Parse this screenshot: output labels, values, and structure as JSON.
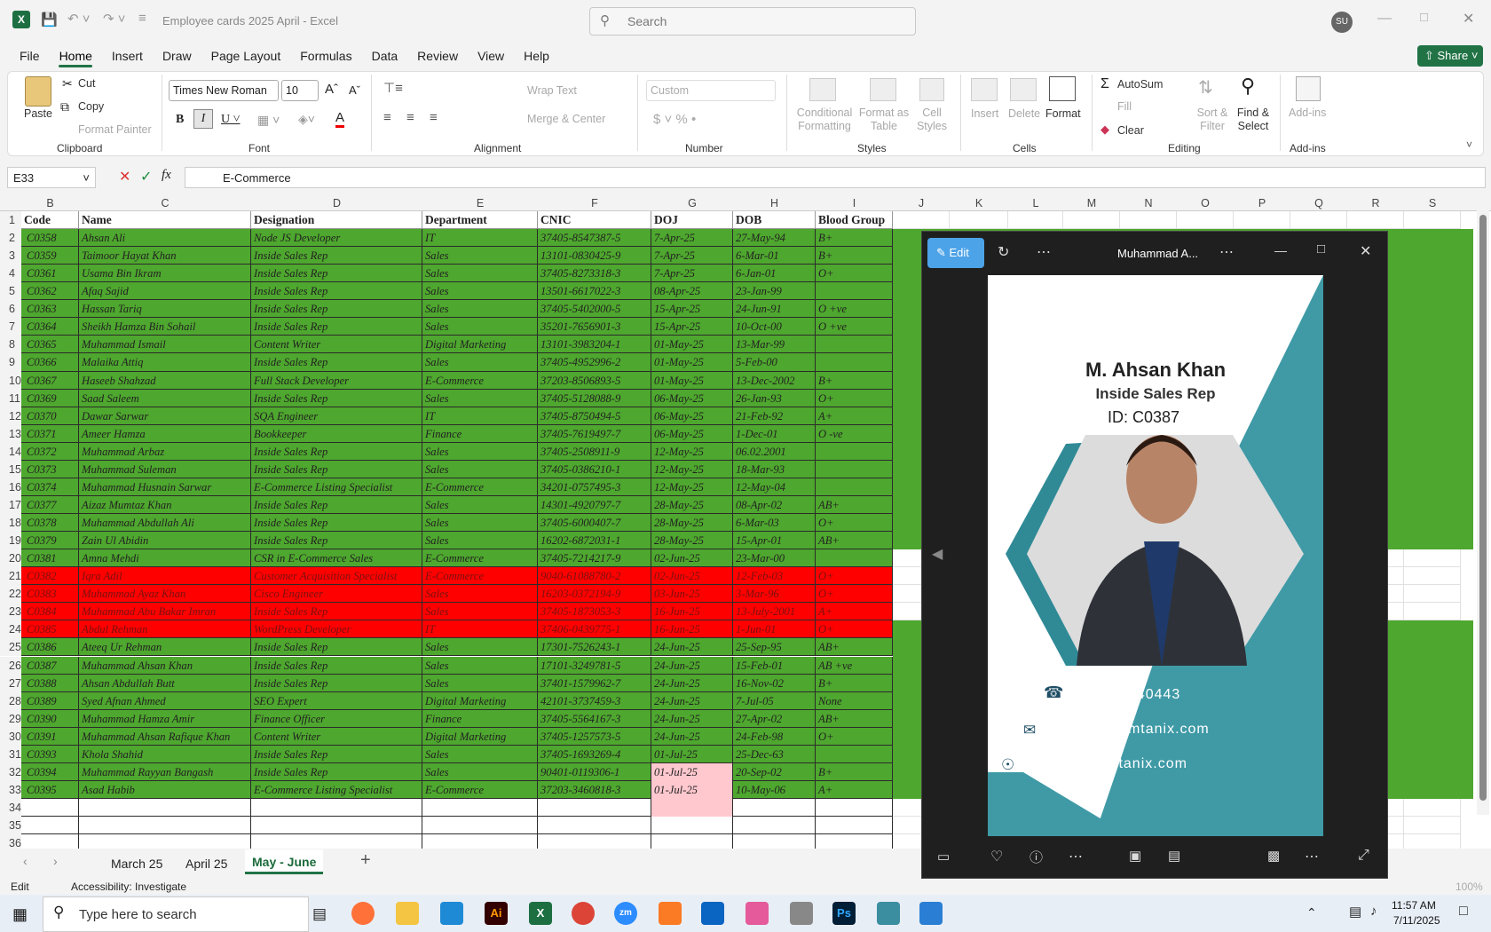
{
  "app": {
    "title": "Employee cards 2025 April - Excel",
    "search_placeholder": "Search",
    "avatar": "SU",
    "share": "Share"
  },
  "menu": [
    "File",
    "Home",
    "Insert",
    "Draw",
    "Page Layout",
    "Formulas",
    "Data",
    "Review",
    "View",
    "Help"
  ],
  "ribbon": {
    "paste": "Paste",
    "cut": "Cut",
    "copy": "Copy",
    "format_painter": "Format Painter",
    "clipboard": "Clipboard",
    "font_name": "Times New Roman",
    "font_size": "10",
    "font": "Font",
    "wrap_text": "Wrap Text",
    "merge_center": "Merge & Center",
    "alignment": "Alignment",
    "number_format": "Custom",
    "number": "Number",
    "conditional_formatting": "Conditional Formatting",
    "format_as_table": "Format as Table",
    "cell_styles": "Cell Styles",
    "styles": "Styles",
    "insert": "Insert",
    "delete": "Delete",
    "format": "Format",
    "cells": "Cells",
    "autosum": "AutoSum",
    "fill": "Fill",
    "clear": "Clear",
    "sort_filter": "Sort & Filter",
    "find_select": "Find & Select",
    "editing": "Editing",
    "addins": "Add-ins",
    "addins_group": "Add-ins"
  },
  "formula_bar": {
    "name_box": "E33",
    "formula": "E-Commerce"
  },
  "columns": [
    "B",
    "C",
    "D",
    "E",
    "F",
    "G",
    "H",
    "I",
    "J",
    "K",
    "L",
    "M",
    "N",
    "O",
    "P",
    "Q",
    "R",
    "S"
  ],
  "headers": [
    "Code",
    "Name",
    "Designation",
    "Department",
    "CNIC",
    "DOJ",
    "DOB",
    "Blood Group"
  ],
  "rows": [
    [
      "C0358",
      "Ahsan Ali",
      "Node JS Developer",
      "IT",
      "37405-8547387-5",
      "7-Apr-25",
      "27-May-94",
      "B+"
    ],
    [
      "C0359",
      "Taimoor Hayat Khan",
      "Inside Sales Rep",
      "Sales",
      "13101-0830425-9",
      "7-Apr-25",
      "6-Mar-01",
      "B+"
    ],
    [
      "C0361",
      "Usama Bin Ikram",
      "Inside Sales Rep",
      "Sales",
      "37405-8273318-3",
      "7-Apr-25",
      "6-Jan-01",
      "O+"
    ],
    [
      "C0362",
      "Afaq Sajid",
      "Inside Sales Rep",
      "Sales",
      "13501-6617022-3",
      "08-Apr-25",
      "23-Jan-99",
      ""
    ],
    [
      "C0363",
      "Hassan Tariq",
      "Inside Sales Rep",
      "Sales",
      "37405-5402000-5",
      "15-Apr-25",
      "24-Jun-91",
      "O +ve"
    ],
    [
      "C0364",
      "Sheikh Hamza Bin Sohail",
      "Inside Sales Rep",
      "Sales",
      "35201-7656901-3",
      "15-Apr-25",
      "10-Oct-00",
      "O +ve"
    ],
    [
      "C0365",
      "Muhammad Ismail",
      "Content Writer",
      "Digital Marketing",
      "13101-3983204-1",
      "01-May-25",
      "13-Mar-99",
      ""
    ],
    [
      "C0366",
      "Malaika Attiq",
      "Inside Sales Rep",
      "Sales",
      "37405-4952996-2",
      "01-May-25",
      "5-Feb-00",
      ""
    ],
    [
      "C0367",
      "Haseeb Shahzad",
      "Full Stack Developer",
      "E-Commerce",
      "37203-8506893-5",
      "01-May-25",
      "13-Dec-2002",
      "B+"
    ],
    [
      "C0369",
      "Saad Saleem",
      "Inside Sales Rep",
      "Sales",
      "37405-5128088-9",
      "06-May-25",
      "26-Jan-93",
      "O+"
    ],
    [
      "C0370",
      "Dawar Sarwar",
      "SQA Engineer",
      "IT",
      "37405-8750494-5",
      "06-May-25",
      "21-Feb-92",
      "A+"
    ],
    [
      "C0371",
      "Ameer Hamza",
      "Bookkeeper",
      "Finance",
      "37405-7619497-7",
      "06-May-25",
      "1-Dec-01",
      "O -ve"
    ],
    [
      "C0372",
      "Muhammad Arbaz",
      "Inside Sales Rep",
      "Sales",
      "37405-2508911-9",
      "12-May-25",
      "06.02.2001",
      ""
    ],
    [
      "C0373",
      "Muhammad Suleman",
      "Inside Sales Rep",
      "Sales",
      "37405-0386210-1",
      "12-May-25",
      "18-Mar-93",
      ""
    ],
    [
      "C0374",
      "Muhammad Husnain Sarwar",
      "E-Commerce Listing Specialist",
      "E-Commerce",
      "34201-0757495-3",
      "12-May-25",
      "12-May-04",
      ""
    ],
    [
      "C0377",
      "Aizaz Mumtaz Khan",
      "Inside Sales Rep",
      "Sales",
      "14301-4920797-7",
      "28-May-25",
      "08-Apr-02",
      "AB+"
    ],
    [
      "C0378",
      "Muhammad Abdullah Ali",
      "Inside Sales Rep",
      "Sales",
      "37405-6000407-7",
      "28-May-25",
      "6-Mar-03",
      "O+"
    ],
    [
      "C0379",
      "Zain Ul Abidin",
      "Inside Sales Rep",
      "Sales",
      "16202-6872031-1",
      "28-May-25",
      "15-Apr-01",
      "AB+"
    ],
    [
      "C0381",
      "Amna Mehdi",
      "CSR in E-Commerce Sales",
      "E-Commerce",
      "37405-7214217-9",
      "02-Jun-25",
      "23-Mar-00",
      ""
    ],
    [
      "C0382",
      "Iqra Adil",
      "Customer Acquisition Specialist",
      "E-Commerce",
      "9040-61088780-2",
      "02-Jun-25",
      "12-Feb-03",
      "O+"
    ],
    [
      "C0383",
      "Muhammad Ayaz Khan",
      "Cisco Engineer",
      "Sales",
      "16203-0372194-9",
      "03-Jun-25",
      "3-Mar-96",
      "O+"
    ],
    [
      "C0384",
      "Muhammad Abu Bakar Imran",
      "Inside Sales Rep",
      "Sales",
      "37405-1873053-3",
      "16-Jun-25",
      "13-July-2001",
      "A+"
    ],
    [
      "C0385",
      "Abdul Rehman",
      "WordPress Developer",
      "IT",
      "37406-0439775-1",
      "16-Jun-25",
      "1-Jun-01",
      "O+"
    ],
    [
      "C0386",
      "Ateeq Ur Rehman",
      "Inside Sales Rep",
      "Sales",
      "17301-7526243-1",
      "24-Jun-25",
      "25-Sep-95",
      "AB+"
    ],
    [
      "C0387",
      "Muhammad Ahsan Khan",
      "Inside Sales Rep",
      "Sales",
      "17101-3249781-5",
      "24-Jun-25",
      "15-Feb-01",
      "AB +ve"
    ],
    [
      "C0388",
      "Ahsan Abdullah Butt",
      "Inside Sales Rep",
      "Sales",
      "37401-1579962-7",
      "24-Jun-25",
      "16-Nov-02",
      "B+"
    ],
    [
      "C0389",
      "Syed Afnan Ahmed",
      "SEO Expert",
      "Digital Marketing",
      "42101-3737459-3",
      "24-Jun-25",
      "7-Jul-05",
      "None"
    ],
    [
      "C0390",
      "Muhammad Hamza Amir",
      "Finance Officer",
      "Finance",
      "37405-5564167-3",
      "24-Jun-25",
      "27-Apr-02",
      "AB+"
    ],
    [
      "C0391",
      "Muhammad Ahsan Rafique Khan",
      "Content Writer",
      "Digital Marketing",
      "37405-1257573-5",
      "24-Jun-25",
      "24-Feb-98",
      "O+"
    ],
    [
      "C0393",
      "Khola Shahid",
      "Inside Sales Rep",
      "Sales",
      "37405-1693269-4",
      "01-Jul-25",
      "25-Dec-63",
      ""
    ],
    [
      "C0394",
      "Muhammad Rayyan Bangash",
      "Inside Sales Rep",
      "Sales",
      "90401-0119306-1",
      "01-Jul-25",
      "20-Sep-02",
      "B+"
    ],
    [
      "C0395",
      "Asad Habib",
      "E-Commerce Listing Specialist",
      "E-Commerce",
      "37203-3460818-3",
      "01-Jul-25",
      "10-May-06",
      "A+"
    ]
  ],
  "colors": {
    "green": "#4ea72e",
    "red": "#ff0000",
    "pink": "#ffc7ce",
    "teal": "#3f9aa6",
    "accent": "#217346"
  },
  "sheets": [
    "March 25",
    "April 25",
    "May - June"
  ],
  "status": {
    "mode": "Edit",
    "accessibility": "Accessibility: Investigate",
    "zoom": "100%"
  },
  "viewer": {
    "edit": "Edit",
    "title": "Muhammad A...",
    "card": {
      "name": "M. Ahsan Khan",
      "role": "Inside Sales Rep",
      "id": "ID: C0387",
      "phone": "051-8440443",
      "email": "info@comtanix.com",
      "web": "www.comtanix.com"
    }
  },
  "taskbar": {
    "search": "Type here to search",
    "time": "11:57 AM",
    "date": "7/11/2025"
  }
}
